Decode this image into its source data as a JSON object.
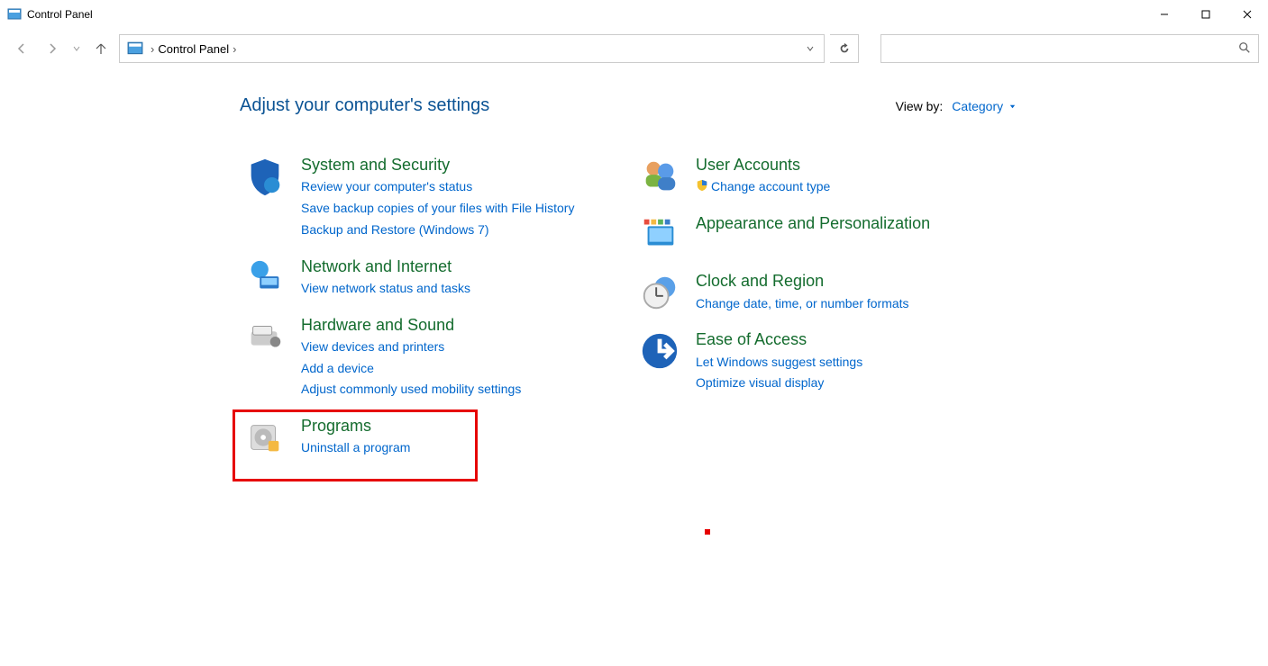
{
  "window": {
    "title": "Control Panel"
  },
  "breadcrumb": {
    "root": "Control Panel"
  },
  "page": {
    "title": "Adjust your computer's settings",
    "view_by_label": "View by:",
    "view_by_value": "Category"
  },
  "left_categories": [
    {
      "id": "system-security",
      "title": "System and Security",
      "links": [
        "Review your computer's status",
        "Save backup copies of your files with File History",
        "Backup and Restore (Windows 7)"
      ]
    },
    {
      "id": "network-internet",
      "title": "Network and Internet",
      "links": [
        "View network status and tasks"
      ]
    },
    {
      "id": "hardware-sound",
      "title": "Hardware and Sound",
      "links": [
        "View devices and printers",
        "Add a device",
        "Adjust commonly used mobility settings"
      ]
    },
    {
      "id": "programs",
      "title": "Programs",
      "highlighted": true,
      "links": [
        "Uninstall a program"
      ]
    }
  ],
  "right_categories": [
    {
      "id": "user-accounts",
      "title": "User Accounts",
      "links_shielded": [
        "Change account type"
      ]
    },
    {
      "id": "appearance",
      "title": "Appearance and Personalization",
      "links": []
    },
    {
      "id": "clock-region",
      "title": "Clock and Region",
      "links": [
        "Change date, time, or number formats"
      ]
    },
    {
      "id": "ease-of-access",
      "title": "Ease of Access",
      "links": [
        "Let Windows suggest settings",
        "Optimize visual display"
      ]
    }
  ]
}
